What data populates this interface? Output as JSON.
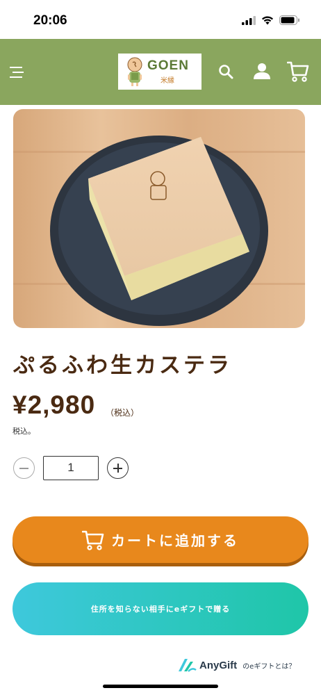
{
  "status_bar": {
    "time": "20:06"
  },
  "header": {
    "logo_text": "GOEN",
    "logo_sub": "米縁",
    "background": "#8aa65e",
    "icons": [
      "menu-icon",
      "search-icon",
      "user-icon",
      "cart-icon"
    ]
  },
  "product": {
    "title": "ぷるふわ生カステラ",
    "price": "¥2,980",
    "price_tax_label": "（税込）",
    "tax_note": "税込。",
    "quantity": "1"
  },
  "actions": {
    "add_to_cart_label": "カートに追加する",
    "add_to_cart_color": "#e8881c",
    "gift_label": "住所を知らない相手にeギフトで贈る"
  },
  "anygift": {
    "brand": "AnyGift",
    "question": "のeギフトとは？"
  }
}
